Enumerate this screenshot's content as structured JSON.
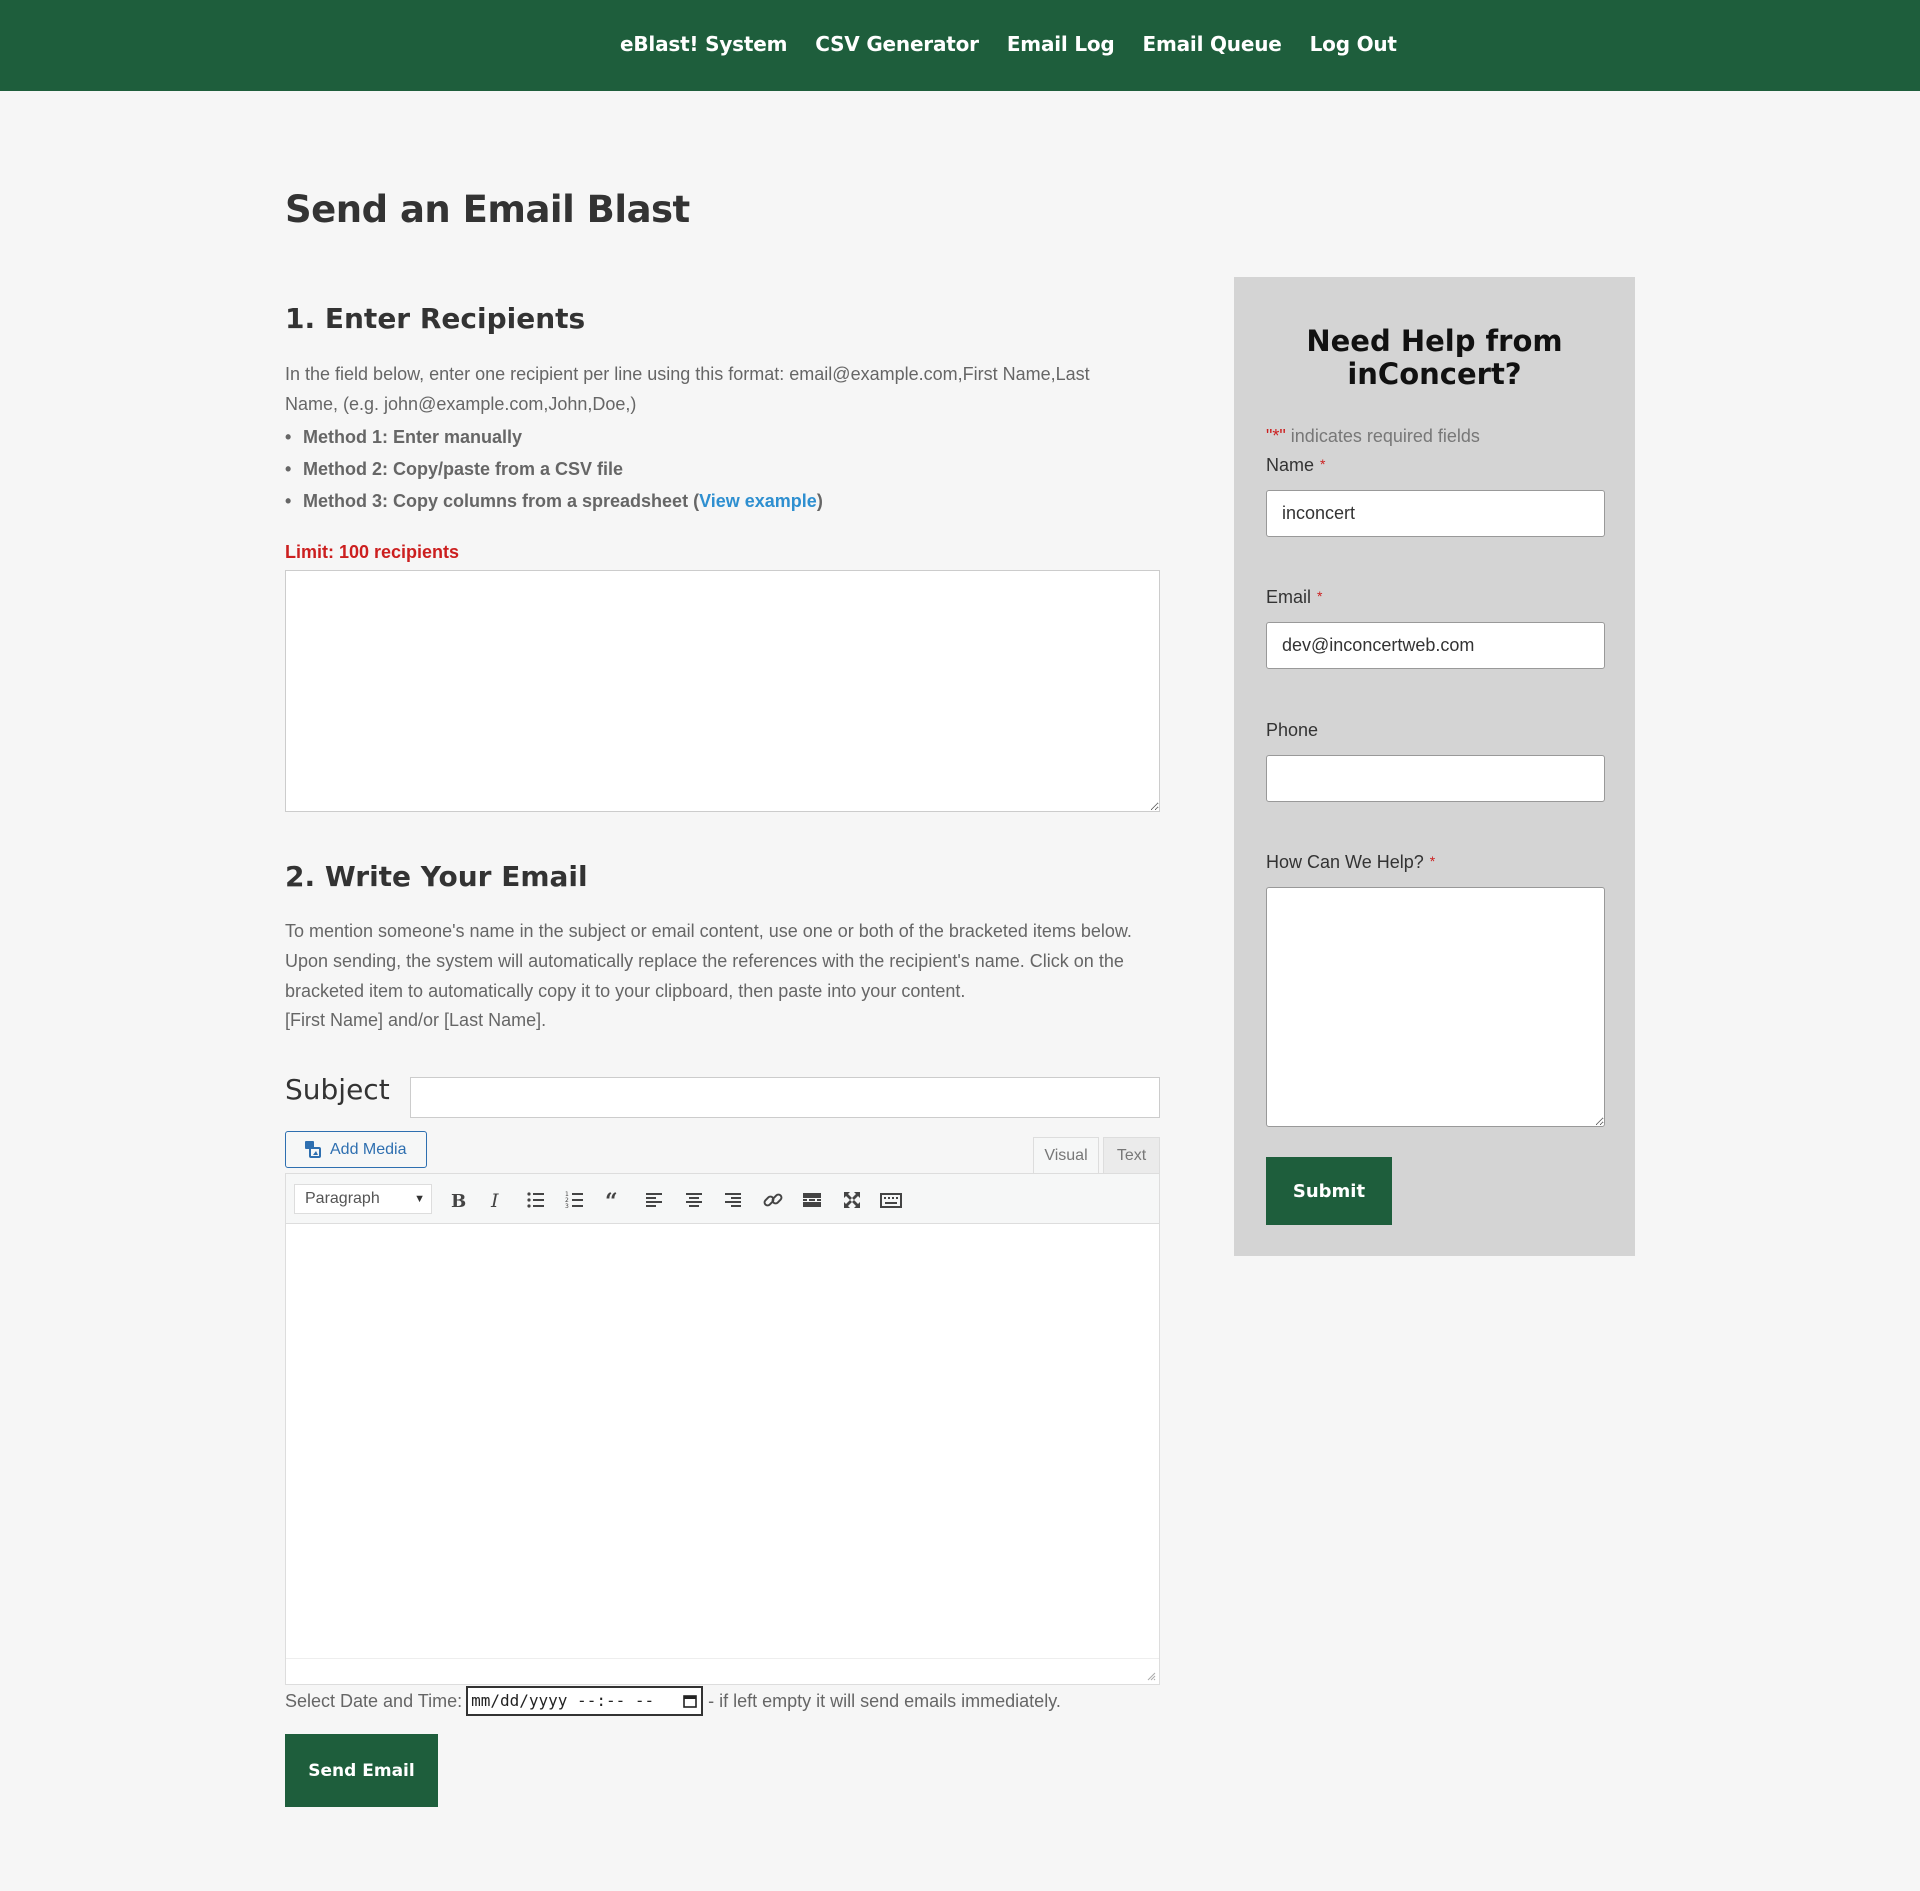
{
  "nav": {
    "items": [
      {
        "label": "eBlast! System"
      },
      {
        "label": "CSV Generator"
      },
      {
        "label": "Email Log"
      },
      {
        "label": "Email Queue"
      },
      {
        "label": "Log Out"
      }
    ]
  },
  "page": {
    "title": "Send an Email Blast"
  },
  "recipients": {
    "heading": "1. Enter Recipients",
    "instructions": "In the field below, enter one recipient per line using this format: email@example.com,First Name,Last Name, (e.g. john@example.com,John,Doe,)",
    "methods": [
      "Method 1: Enter manually",
      "Method 2: Copy/paste from a CSV file"
    ],
    "method3_prefix": "Method 3: Copy columns from a spreadsheet (",
    "method3_link": "View example",
    "method3_suffix": ")",
    "limit": "Limit: 100 recipients",
    "textarea_value": ""
  },
  "email": {
    "heading": "2. Write Your Email",
    "instructions": "To mention someone's name in the subject or email content, use one or both of the bracketed items below. Upon sending, the system will automatically replace the references with the recipient's name. Click on the bracketed item to automatically copy it to your clipboard, then paste into your content.",
    "placeholders": "[First Name] and/or [Last Name].",
    "subject_label": "Subject",
    "subject_value": "",
    "add_media_label": "Add Media",
    "tab_visual": "Visual",
    "tab_text": "Text",
    "format_selected": "Paragraph",
    "schedule_label": "Select Date and Time:",
    "datetime_placeholder": "mm/dd/yyyy --:-- --",
    "schedule_note": "- if left empty it will send emails immediately.",
    "send_label": "Send Email"
  },
  "toolbar_icons": [
    "bold-icon",
    "italic-icon",
    "bullet-list-icon",
    "numbered-list-icon",
    "blockquote-icon",
    "align-left-icon",
    "align-center-icon",
    "align-right-icon",
    "link-icon",
    "read-more-icon",
    "fullscreen-icon",
    "toolbar-toggle-icon"
  ],
  "help": {
    "title": "Need Help from inConcert?",
    "required_note_star": "\"*\"",
    "required_note": " indicates required fields",
    "name_label": "Name",
    "name_value": "inconcert",
    "email_label": "Email",
    "email_value": "dev@inconcertweb.com",
    "phone_label": "Phone",
    "phone_value": "",
    "help_label": "How Can We Help?",
    "required_star": "*",
    "submit_label": "Submit"
  },
  "colors": {
    "brand_green": "#1e5e3c",
    "link_blue": "#2e8fd0",
    "required_red": "#cc1f1f",
    "panel_gray": "#d4d4d4"
  }
}
